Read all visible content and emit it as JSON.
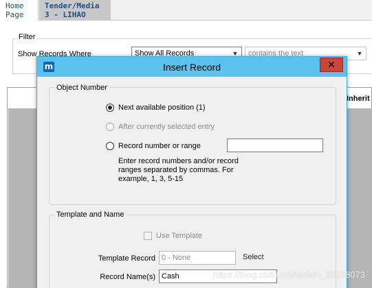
{
  "tabs": [
    {
      "label": "Home\nPage"
    },
    {
      "label": "Tender/Media\n3 - LIHAO"
    }
  ],
  "tabs_text": {
    "home_l1": "Home",
    "home_l2": "Page",
    "tender_l1": "Tender/Media",
    "tender_l2": "3 - LIHAO"
  },
  "filter": {
    "group_label": "Filter",
    "show_label": "Show Records Where",
    "select_value": "Show All Records",
    "condition_value": "contains the text"
  },
  "grid": {
    "column_header": "Inherit"
  },
  "dialog": {
    "title": "Insert Record",
    "app_icon": "m",
    "close_symbol": "✕",
    "object_number": {
      "group_label": "Object Number",
      "options": [
        {
          "label": "Next available position (1)",
          "selected": true,
          "enabled": true
        },
        {
          "label": "After currently selected entry",
          "selected": false,
          "enabled": false
        },
        {
          "label": "Record number or range",
          "selected": false,
          "enabled": true
        }
      ],
      "range_value": "",
      "hint": "Enter record numbers and/or record ranges separated by commas. For example, 1, 3, 5-15"
    },
    "template_and_name": {
      "group_label": "Template and Name",
      "use_template_label": "Use Template",
      "use_template_checked": false,
      "template_record_label": "Template Record",
      "template_record_value": "0 - None",
      "select_label": "Select",
      "record_names_label": "Record Name(s)",
      "record_names_value": "Cash"
    }
  },
  "watermark": "https://blog.csdn.net/weixin_39568073",
  "colors": {
    "titlebar": "#5cc1ec",
    "close": "#c9463d",
    "accent": "#0f66b8"
  }
}
